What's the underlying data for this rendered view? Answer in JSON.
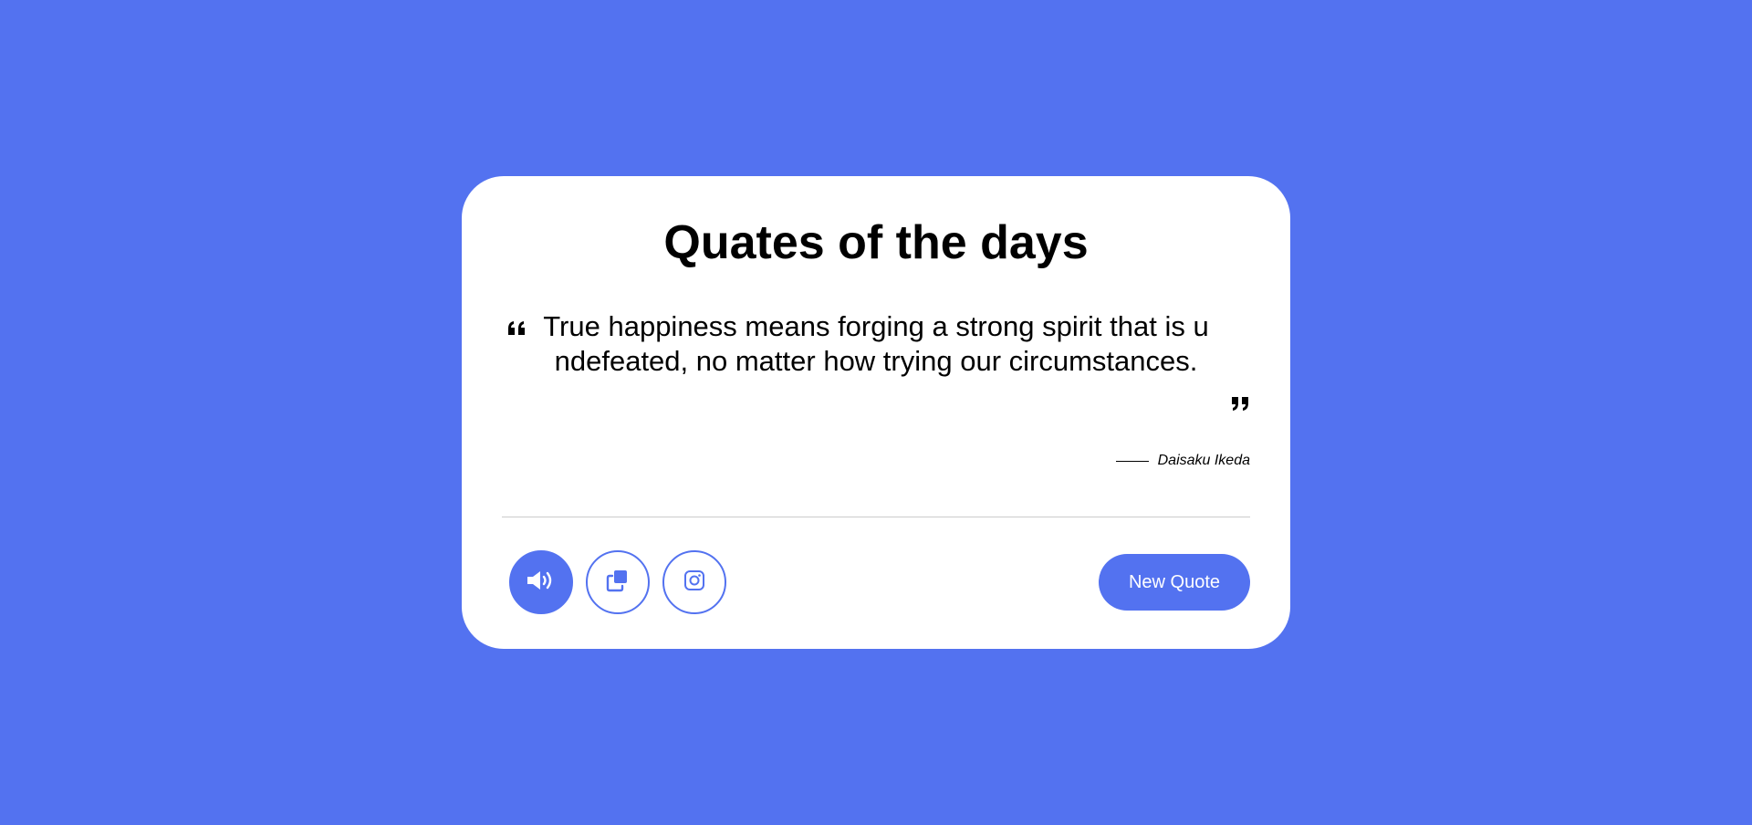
{
  "header": {
    "title": "Quates of the days"
  },
  "quote": {
    "text": "True happiness means forging a strong spirit that is undefeated, no matter how trying our circumstances.",
    "open_icon": "quote-left-icon",
    "close_icon": "quote-right-icon"
  },
  "author": {
    "name": "Daisaku Ikeda"
  },
  "actions": {
    "speak_icon": "volume-icon",
    "copy_icon": "copy-icon",
    "instagram_icon": "instagram-icon",
    "new_quote_label": "New Quote"
  },
  "colors": {
    "accent": "#5372F0",
    "card": "#ffffff",
    "text": "#000000",
    "divider": "#cccccc"
  }
}
